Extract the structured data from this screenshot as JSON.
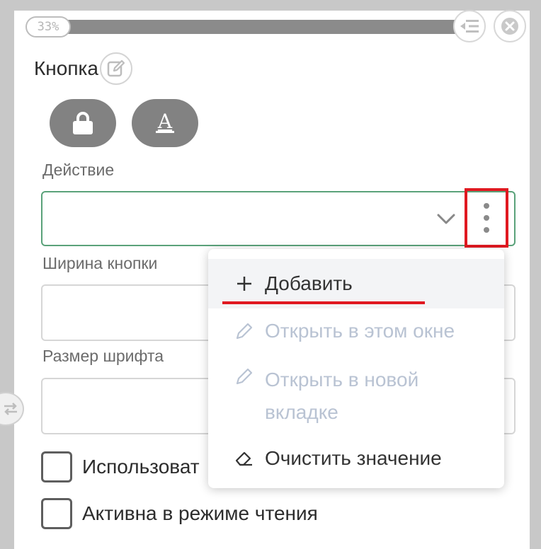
{
  "progress": {
    "label": "33%",
    "value_percent": 33
  },
  "component": {
    "title": "Кнопка"
  },
  "fields": {
    "action": {
      "label": "Действие",
      "value": ""
    },
    "button_width": {
      "label": "Ширина кнопки",
      "value": ""
    },
    "font_size": {
      "label": "Размер шрифта",
      "value": ""
    }
  },
  "checkboxes": {
    "use": {
      "label": "Использоват",
      "checked": false
    },
    "active_readonly": {
      "label": "Активна в режиме чтения",
      "checked": false
    }
  },
  "menu": {
    "add": "Добавить",
    "open_same": "Открыть в этом окне",
    "open_new_line1": "Открыть в новой",
    "open_new_line2": "вкладке",
    "clear": "Очистить значение"
  },
  "icons": [
    "collapse-icon",
    "close-icon",
    "edit-icon",
    "lock-icon",
    "font-icon",
    "chevron-down-icon",
    "more-vertical-icon",
    "swap-icon",
    "plus-icon",
    "pencil-icon",
    "eraser-icon"
  ],
  "colors": {
    "highlight": "#e01921",
    "focus_border": "#5aa27a",
    "disabled_text": "#b9c3d3",
    "pill_bg": "#828282"
  }
}
